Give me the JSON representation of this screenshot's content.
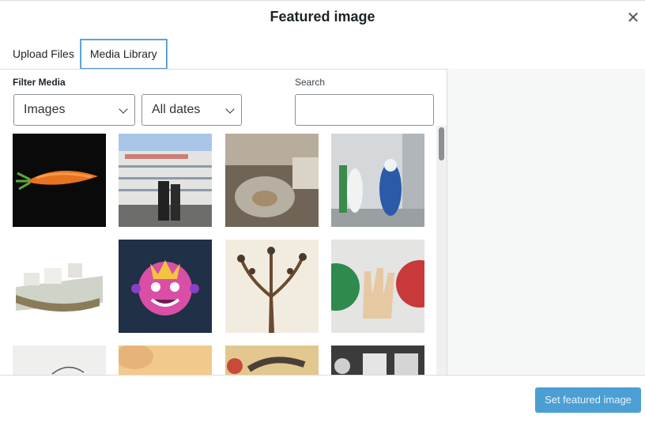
{
  "modal": {
    "title": "Featured image",
    "close_icon": "close-icon"
  },
  "tabs": [
    {
      "label": "Upload Files",
      "active": false
    },
    {
      "label": "Media Library",
      "active": true
    }
  ],
  "filters": {
    "label": "Filter Media",
    "type_selected": "Images",
    "date_selected": "All dates"
  },
  "search": {
    "label": "Search",
    "value": ""
  },
  "media_items": [
    {
      "name": "carrot-image"
    },
    {
      "name": "building-street-image"
    },
    {
      "name": "hospital-incubator-image"
    },
    {
      "name": "hazmat-disinfection-image"
    },
    {
      "name": "village-houses-image"
    },
    {
      "name": "virus-monster-image"
    },
    {
      "name": "animal-tree-illustration-image"
    },
    {
      "name": "hand-stop-signs-image"
    },
    {
      "name": "sketch-image"
    },
    {
      "name": "beige-image"
    },
    {
      "name": "vintage-illustration-image"
    },
    {
      "name": "dark-photo-image"
    }
  ],
  "footer": {
    "primary_button": "Set featured image"
  },
  "colors": {
    "accent": "#2271b1",
    "primary_button": "#2c8fcd",
    "active_tab_border": "#4f94d4"
  }
}
